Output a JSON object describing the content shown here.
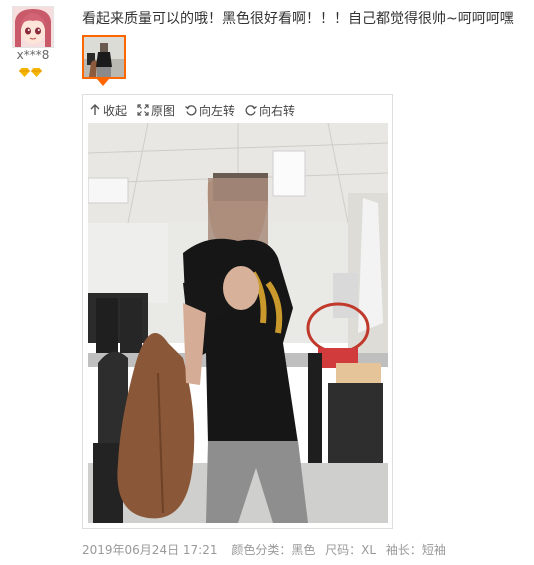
{
  "user": {
    "name": "x***8",
    "avatar_icon": "anime-girl-avatar-icon",
    "badge_icon": "diamond-icon",
    "badge_count": 2
  },
  "review": {
    "text": "看起来质量可以的哦！黑色很好看啊！！！自己都觉得很帅~呵呵呵嘿"
  },
  "viewer": {
    "toolbar": {
      "collapse": "收起",
      "original": "原图",
      "rotate_left": "向左转",
      "rotate_right": "向右转"
    }
  },
  "meta": {
    "date": "2019年06月24日 17:21",
    "color": "颜色分类：黑色",
    "size": "尺码：XL",
    "sleeve": "袖长：短袖"
  },
  "colors": {
    "accent": "#ff6600",
    "meta_text": "#999999"
  }
}
